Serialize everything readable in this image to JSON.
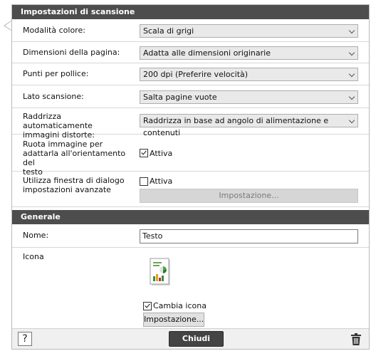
{
  "scan_settings": {
    "header": "Impostazioni di scansione",
    "color_mode": {
      "label": "Modalità colore:",
      "value": "Scala di grigi"
    },
    "page_size": {
      "label": "Dimensioni della pagina:",
      "value": "Adatta alle dimensioni originarie"
    },
    "dpi": {
      "label": "Punti per pollice:",
      "value": "200 dpi (Preferire velocità)"
    },
    "scan_side": {
      "label": "Lato scansione:",
      "value": "Salta pagine vuote"
    },
    "deskew": {
      "label_line1": "Raddrizza automaticamente",
      "label_line2": "immagini distorte:",
      "value": "Raddrizza in base ad angolo di alimentazione e contenuti"
    },
    "rotate": {
      "label_line1": "Ruota immagine per",
      "label_line2": "adattarla all'orientamento del",
      "label_line3": "testo",
      "checkbox_label": "Attiva",
      "checked": true
    },
    "advanced": {
      "label_line1": "Utilizza finestra di dialogo",
      "label_line2": "impostazioni avanzate",
      "checkbox_label": "Attiva",
      "checked": false,
      "button_label": "Impostazione..."
    }
  },
  "general": {
    "header": "Generale",
    "name": {
      "label": "Nome:",
      "value": "Testo"
    },
    "icon": {
      "label": "Icona",
      "change_label": "Cambia icona",
      "change_checked": true,
      "button_label": "Impostazione..."
    }
  },
  "footer": {
    "help_label": "?",
    "close_label": "Chiudi"
  },
  "colors": {
    "header_bg": "#4d4d4d",
    "close_bg": "#444444"
  }
}
